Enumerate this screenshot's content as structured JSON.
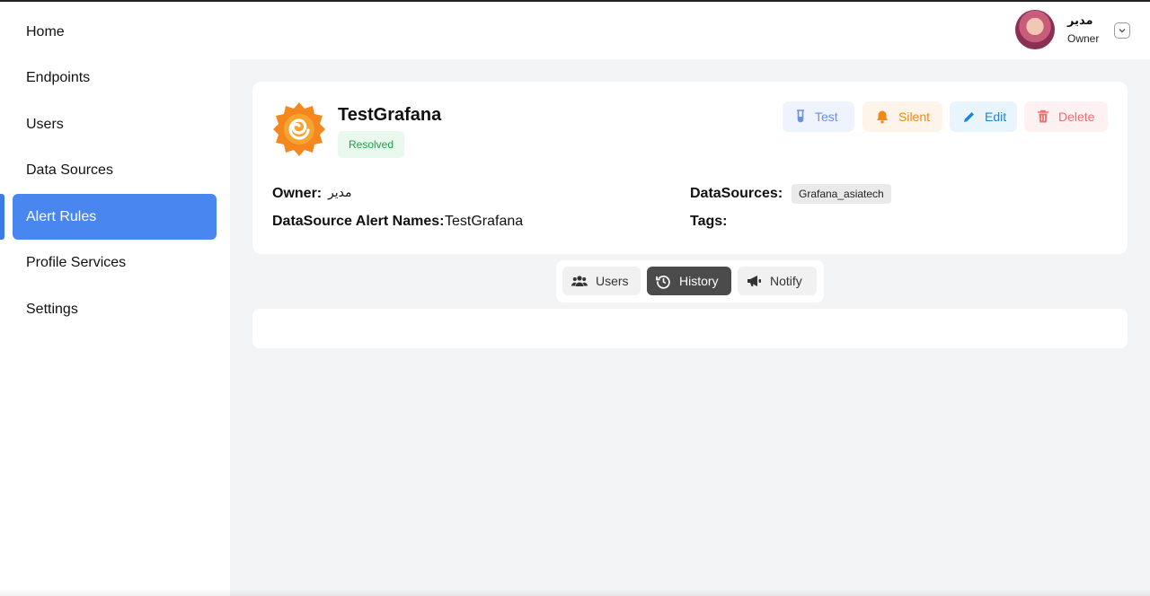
{
  "sidebar": {
    "items": [
      {
        "label": "Home"
      },
      {
        "label": "Endpoints"
      },
      {
        "label": "Users"
      },
      {
        "label": "Data Sources"
      },
      {
        "label": "Alert Rules",
        "active": true
      },
      {
        "label": "Profile Services"
      },
      {
        "label": "Settings"
      }
    ]
  },
  "header": {
    "user_name": "مدیر",
    "user_role": "Owner"
  },
  "rule": {
    "title": "TestGrafana",
    "status": "Resolved",
    "actions": {
      "test": "Test",
      "silent": "Silent",
      "edit": "Edit",
      "delete": "Delete"
    },
    "owner_label": "Owner:",
    "owner_value": "مدیر",
    "alert_names_label": "DataSource Alert Names:",
    "alert_names_value": "TestGrafana",
    "datasources_label": "DataSources:",
    "datasource_chip": "Grafana_asiatech",
    "tags_label": "Tags:"
  },
  "tabs": {
    "users": "Users",
    "history": "History",
    "notify": "Notify",
    "active": "history"
  },
  "colors": {
    "accent": "#4a86f0",
    "resolved": "#1aa34a",
    "test": "#6a90e0",
    "silent": "#f08a16",
    "edit": "#1b86d6",
    "delete": "#ee6d6d",
    "grafana_logo": "#f4881f"
  },
  "icons": {
    "test": "test-tube-icon",
    "silent": "bell-icon",
    "edit": "pencil-icon",
    "delete": "trash-icon",
    "users": "users-icon",
    "history": "history-icon",
    "notify": "megaphone-icon"
  }
}
